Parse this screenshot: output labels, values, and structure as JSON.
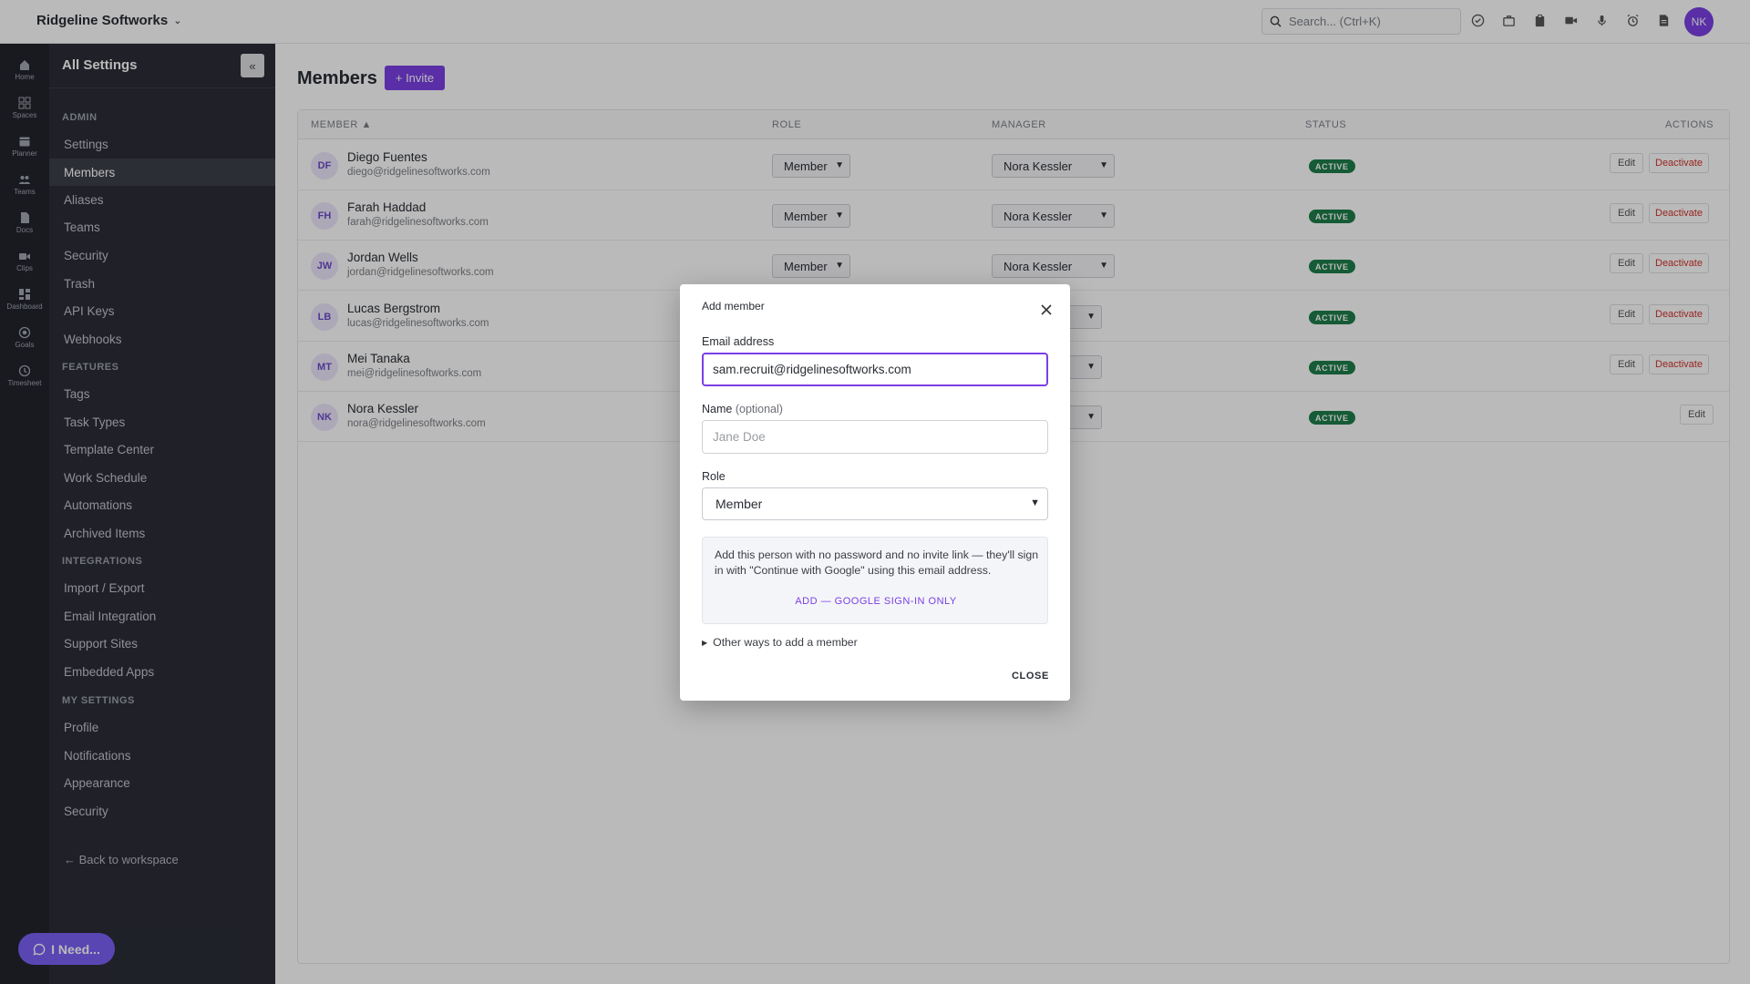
{
  "topbar": {
    "workspace_name": "Ridgeline Softworks",
    "search_placeholder": "Search... (Ctrl+K)",
    "user_initials": "NK",
    "icons": [
      "check-circle-icon",
      "briefcase-icon",
      "clipboard-icon",
      "video-icon",
      "microphone-icon",
      "alarm-icon",
      "document-icon"
    ]
  },
  "rail": {
    "items": [
      {
        "label": "Home",
        "icon": "home-icon"
      },
      {
        "label": "Spaces",
        "icon": "grid-icon"
      },
      {
        "label": "Planner",
        "icon": "calendar-icon"
      },
      {
        "label": "Teams",
        "icon": "people-icon"
      },
      {
        "label": "Docs",
        "icon": "doc-icon"
      },
      {
        "label": "Clips",
        "icon": "camera-icon"
      },
      {
        "label": "Dashboard",
        "icon": "dashboard-icon"
      },
      {
        "label": "Goals",
        "icon": "target-icon"
      },
      {
        "label": "Timesheet",
        "icon": "clock-icon"
      }
    ]
  },
  "sidebar": {
    "title": "All Settings",
    "collapse_icon": "double-chevron-left-icon",
    "sections": {
      "admin": "ADMIN",
      "features": "FEATURES",
      "integrations": "INTEGRATIONS",
      "my_settings": "MY SETTINGS"
    },
    "admin_items": [
      "Settings",
      "Members",
      "Aliases",
      "Teams",
      "Security",
      "Trash",
      "API Keys",
      "Webhooks"
    ],
    "feature_items": [
      "Tags",
      "Task Types",
      "Template Center",
      "Work Schedule",
      "Automations",
      "Archived Items"
    ],
    "integration_items": [
      "Import / Export",
      "Email Integration",
      "Support Sites",
      "Embedded Apps"
    ],
    "my_items": [
      "Profile",
      "Notifications",
      "Appearance",
      "Security"
    ],
    "back_link": "← Back to workspace",
    "active_item": "Members"
  },
  "help_button": {
    "label": "I Need..."
  },
  "main": {
    "title": "Members",
    "invite_label": "+ Invite",
    "columns": {
      "member": "MEMBER ▲",
      "role": "ROLE",
      "manager": "MANAGER",
      "status": "STATUS",
      "actions": "ACTIONS"
    },
    "edit_label": "Edit",
    "deactivate_label": "Deactivate",
    "members": [
      {
        "initials": "DF",
        "name": "Diego Fuentes",
        "email": "diego@ridgelinesoftworks.com",
        "role": "Member",
        "manager": "Nora Kessler",
        "status": "ACTIVE"
      },
      {
        "initials": "FH",
        "name": "Farah Haddad",
        "email": "farah@ridgelinesoftworks.com",
        "role": "Member",
        "manager": "Nora Kessler",
        "status": "ACTIVE"
      },
      {
        "initials": "JW",
        "name": "Jordan Wells",
        "email": "jordan@ridgelinesoftworks.com",
        "role": "Member",
        "manager": "Nora Kessler",
        "status": "ACTIVE"
      },
      {
        "initials": "LB",
        "name": "Lucas Bergstrom",
        "email": "lucas@ridgelinesoftworks.com",
        "status": "ACTIVE"
      },
      {
        "initials": "MT",
        "name": "Mei Tanaka",
        "email": "mei@ridgelinesoftworks.com",
        "status": "ACTIVE"
      },
      {
        "initials": "NK",
        "name": "Nora Kessler",
        "email": "nora@ridgelinesoftworks.com",
        "status": "ACTIVE"
      }
    ]
  },
  "modal": {
    "title": "Add member",
    "email_label": "Email address",
    "email_value": "sam.recruit@ridgelinesoftworks.com",
    "name_label": "Name",
    "name_optional": "(optional)",
    "name_placeholder": "Jane Doe",
    "role_label": "Role",
    "role_value": "Member",
    "info_text": "Add this person with no password and no invite link — they'll sign in with \"Continue with Google\" using this email address.",
    "google_link": "ADD — GOOGLE SIGN-IN ONLY",
    "other_ways": "Other ways to add a member",
    "close_label": "CLOSE"
  }
}
